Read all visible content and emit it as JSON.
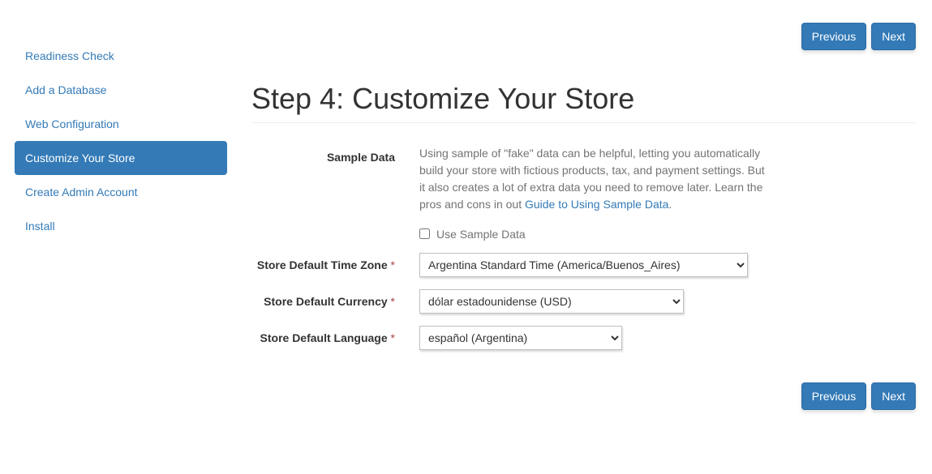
{
  "sidebar": {
    "items": [
      {
        "label": "Readiness Check"
      },
      {
        "label": "Add a Database"
      },
      {
        "label": "Web Configuration"
      },
      {
        "label": "Customize Your Store"
      },
      {
        "label": "Create Admin Account"
      },
      {
        "label": "Install"
      }
    ]
  },
  "buttons": {
    "previous": "Previous",
    "next": "Next"
  },
  "page": {
    "title": "Step 4: Customize Your Store"
  },
  "sampleData": {
    "label": "Sample Data",
    "helpPrefix": "Using sample of \"fake\" data can be helpful, letting you automatically build your store with fictious products, tax, and payment settings. But it also creates a lot of extra data you need to remove later. Learn the pros and cons in out ",
    "linkText": "Guide to Using Sample Data",
    "helpSuffix": ".",
    "checkboxLabel": "Use Sample Data"
  },
  "timezone": {
    "label": "Store Default Time Zone",
    "required": "*",
    "value": "Argentina Standard Time (America/Buenos_Aires)"
  },
  "currency": {
    "label": "Store Default Currency",
    "required": "*",
    "value": "dólar estadounidense (USD)"
  },
  "language": {
    "label": "Store Default Language",
    "required": "*",
    "value": "español (Argentina)"
  }
}
